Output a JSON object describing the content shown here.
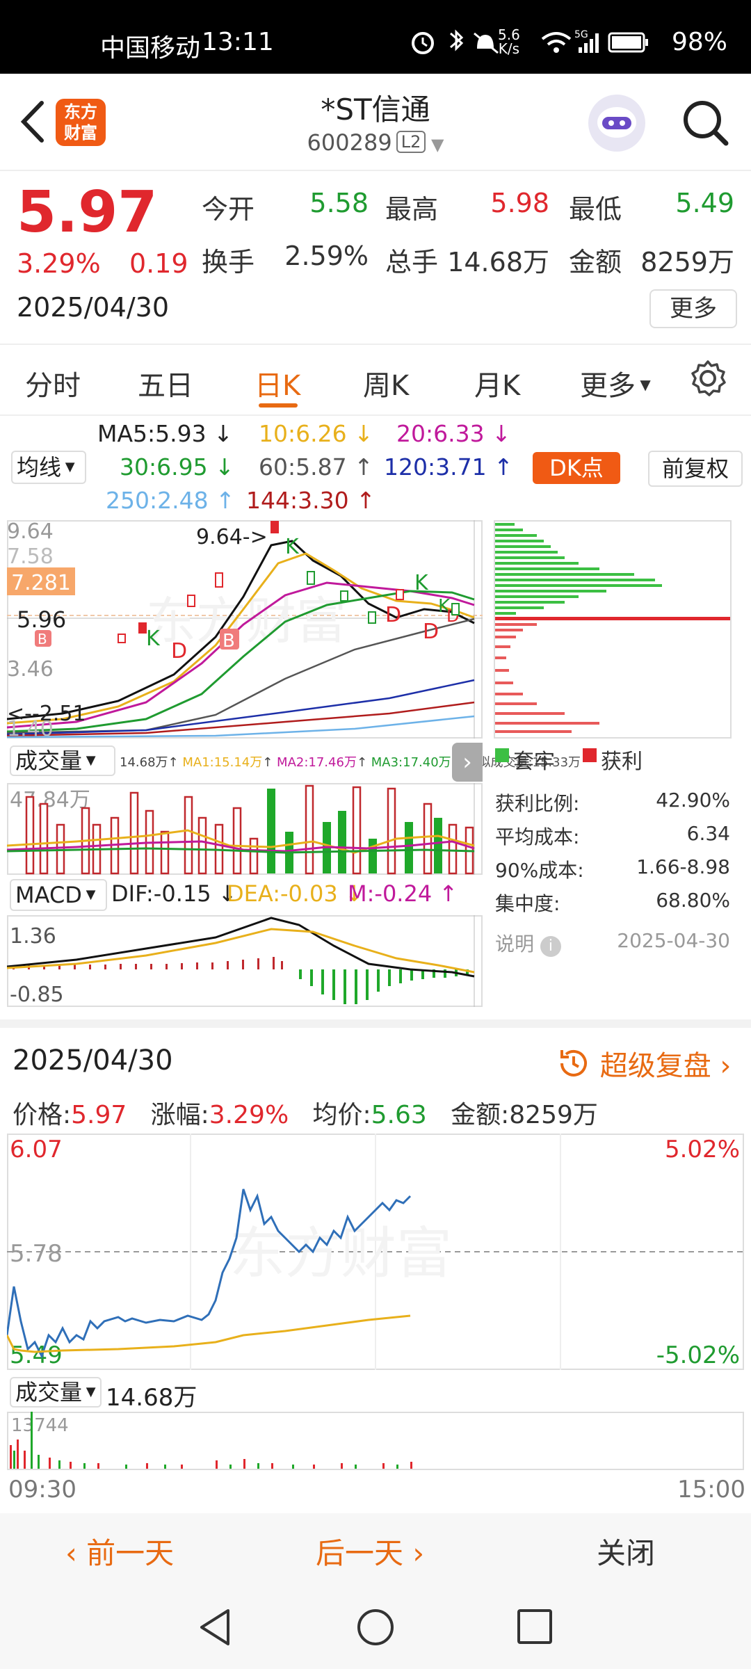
{
  "status_bar": {
    "carrier": "中国移动",
    "time": "13:11",
    "net_speed_top": "5.6",
    "net_speed_bottom": "K/s",
    "battery": "98%"
  },
  "header": {
    "logo_line1": "东方",
    "logo_line2": "财富",
    "title": "*ST信通",
    "code": "600289",
    "level": "L2"
  },
  "quote": {
    "price": "5.97",
    "change_pct": "3.29%",
    "change": "0.19",
    "date": "2025/04/30",
    "open_label": "今开",
    "open": "5.58",
    "high_label": "最高",
    "high": "5.98",
    "low_label": "最低",
    "low": "5.49",
    "turnover_label": "换手",
    "turnover": "2.59%",
    "volume_label": "总手",
    "volume": "14.68万",
    "amount_label": "金额",
    "amount": "8259万",
    "more_label": "更多"
  },
  "tabs": [
    {
      "label": "分时"
    },
    {
      "label": "五日"
    },
    {
      "label": "日K"
    },
    {
      "label": "周K"
    },
    {
      "label": "月K"
    },
    {
      "label": "更多"
    }
  ],
  "ma_legend": {
    "selector": "均线",
    "ma5": "MA5:5.93",
    "ma10": "10:6.26",
    "ma20": "20:6.33",
    "ma30": "30:6.95",
    "ma60": "60:5.87",
    "ma120": "120:3.71",
    "ma250": "250:2.48",
    "ma144": "144:3.30",
    "dk_label": "DK点",
    "adjust_label": "前复权"
  },
  "kchart": {
    "y_labels": [
      "9.64",
      "7.58",
      "3.46",
      "1.40"
    ],
    "current_price_tag": "7.281",
    "crosshair_value": "5.96",
    "high_annotation": "9.64->",
    "low_annotation": "<--2.51",
    "signals": [
      "K",
      "D",
      "B",
      "K",
      "D",
      "K",
      "D",
      "K",
      "D",
      "B"
    ]
  },
  "volume": {
    "selector": "成交量",
    "info": "14.68万",
    "ma1": "MA1:15.14万",
    "ma2": "MA2:17.46万",
    "ma3": "MA3:17.40万",
    "virtual": "虚拟成交量:15.33万",
    "y_label": "47.84万"
  },
  "macd": {
    "selector": "MACD",
    "dif": "DIF:-0.15",
    "dea": "DEA:-0.03",
    "m": "M:-0.24",
    "y_top": "1.36",
    "y_bottom": "-0.85"
  },
  "chip": {
    "legend_trapped": "套牢",
    "legend_profit": "获利",
    "rows": [
      {
        "label": "获利比例:",
        "value": "42.90%"
      },
      {
        "label": "平均成本:",
        "value": "6.34"
      },
      {
        "label": "90%成本:",
        "value": "1.66-8.98"
      },
      {
        "label": "集中度:",
        "value": "68.80%"
      }
    ],
    "note_label": "说明",
    "note_date": "2025-04-30"
  },
  "intraday": {
    "date": "2025/04/30",
    "replay_label": "超级复盘",
    "price_label": "价格:",
    "price": "5.97",
    "rise_label": "涨幅:",
    "rise": "3.29%",
    "avg_label": "均价:",
    "avg": "5.63",
    "amount_label": "金额:",
    "amount": "8259万",
    "y_top": "6.07",
    "y_mid": "5.78",
    "y_bottom": "5.49",
    "pct_top": "5.02%",
    "pct_bottom": "-5.02%",
    "vol_selector": "成交量",
    "vol_total": "14.68万",
    "vol_max": "13744",
    "time_start": "09:30",
    "time_end": "15:00",
    "watermark": "东方财富"
  },
  "bottom_bar": {
    "prev_day": "前一天",
    "next_day": "后一天",
    "close": "关闭"
  },
  "colors": {
    "up": "#e0272d",
    "down": "#1f9b30",
    "accent": "#e86a12"
  }
}
